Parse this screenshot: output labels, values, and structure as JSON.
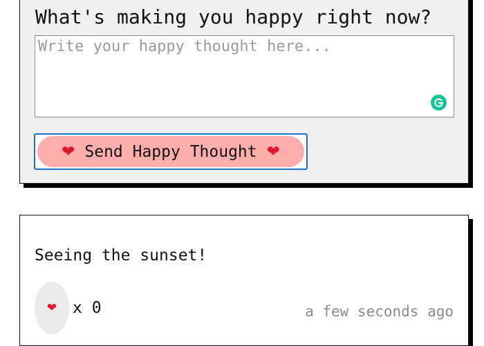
{
  "form": {
    "question": "What's making you happy right now?",
    "textarea_placeholder": "Write your happy thought here...",
    "textarea_value": "",
    "send_button": {
      "heart_left": "❤",
      "label": "Send Happy Thought",
      "heart_right": "❤"
    }
  },
  "thoughts": [
    {
      "message": "Seeing the sunset!",
      "like_heart": "❤",
      "like_count": "x 0",
      "time": "a few seconds ago"
    }
  ],
  "colors": {
    "form_background": "#f1f0f0",
    "button_pink": "#ffadad",
    "heart_red": "#e0182f",
    "focus_blue": "#1e6fc8",
    "grammarly_green": "#15c39a",
    "timestamp_gray": "#8a8a8a"
  },
  "icons": {
    "grammarly": "grammarly-icon",
    "heart": "heart-icon"
  }
}
